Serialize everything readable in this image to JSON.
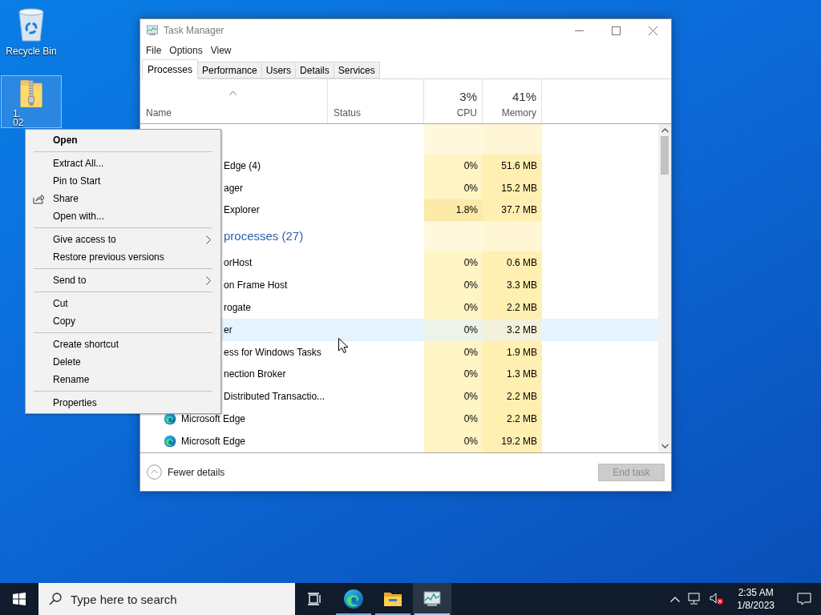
{
  "desktop_icons": [
    {
      "kind": "recycle_bin",
      "label": [
        "Recycle Bin"
      ],
      "selected": false
    },
    {
      "kind": "zip_folder",
      "label": [
        "1.",
        "02"
      ],
      "selected": true
    }
  ],
  "task_manager": {
    "title": "Task Manager",
    "menu": [
      "File",
      "Options",
      "View"
    ],
    "tabs": [
      {
        "label": "Processes",
        "selected": true
      },
      {
        "label": "Performance",
        "selected": false
      },
      {
        "label": "Users",
        "selected": false
      },
      {
        "label": "Details",
        "selected": false
      },
      {
        "label": "Services",
        "selected": false
      }
    ],
    "columns": {
      "name": "Name",
      "status": "Status",
      "cpu": {
        "percent": "3%",
        "label": "CPU"
      },
      "memory": {
        "percent": "41%",
        "label": "Memory"
      }
    },
    "rows": [
      {
        "kind": "group"
      },
      {
        "kind": "process",
        "name": "Edge (4)",
        "cpu": "0%",
        "memory": "51.6 MB",
        "hovered": false,
        "icon_visible": false,
        "cpu_busy": false
      },
      {
        "kind": "process",
        "name": "ager",
        "cpu": "0%",
        "memory": "15.2 MB",
        "hovered": false,
        "icon_visible": false,
        "cpu_busy": false
      },
      {
        "kind": "process",
        "name": "Explorer",
        "cpu": "1.8%",
        "memory": "37.7 MB",
        "hovered": false,
        "icon_visible": false,
        "cpu_busy": true
      },
      {
        "kind": "group",
        "name": "processes (27)"
      },
      {
        "kind": "process",
        "name": "orHost",
        "cpu": "0%",
        "memory": "0.6 MB",
        "hovered": false,
        "icon_visible": false,
        "cpu_busy": false
      },
      {
        "kind": "process",
        "name": "on Frame Host",
        "cpu": "0%",
        "memory": "3.3 MB",
        "hovered": false,
        "icon_visible": false,
        "cpu_busy": false
      },
      {
        "kind": "process",
        "name": "rogate",
        "cpu": "0%",
        "memory": "2.2 MB",
        "hovered": false,
        "icon_visible": false,
        "cpu_busy": false
      },
      {
        "kind": "process",
        "name": "er",
        "cpu": "0%",
        "memory": "3.2 MB",
        "hovered": true,
        "icon_visible": false,
        "cpu_busy": false
      },
      {
        "kind": "process",
        "name": "ess for Windows Tasks",
        "cpu": "0%",
        "memory": "1.9 MB",
        "hovered": false,
        "icon_visible": false,
        "cpu_busy": false
      },
      {
        "kind": "process",
        "name": "nection Broker",
        "cpu": "0%",
        "memory": "1.3 MB",
        "hovered": false,
        "icon_visible": false,
        "cpu_busy": false
      },
      {
        "kind": "process",
        "name": "Distributed Transactio...",
        "cpu": "0%",
        "memory": "2.2 MB",
        "hovered": false,
        "icon_visible": false,
        "cpu_busy": false
      },
      {
        "kind": "process",
        "name": "Microsoft Edge",
        "cpu": "0%",
        "memory": "2.2 MB",
        "hovered": false,
        "icon_visible": true,
        "cpu_busy": false
      },
      {
        "kind": "process",
        "name": "Microsoft Edge",
        "cpu": "0%",
        "memory": "19.2 MB",
        "hovered": false,
        "icon_visible": true,
        "cpu_busy": false
      }
    ],
    "footer": {
      "fewer_details": "Fewer details",
      "end_task": {
        "label": "End task",
        "disabled": true
      }
    }
  },
  "context_menu": [
    {
      "kind": "item",
      "label": "Open",
      "default": true,
      "submenu": false,
      "share_icon": false
    },
    {
      "kind": "separator"
    },
    {
      "kind": "item",
      "label": "Extract All...",
      "default": false,
      "submenu": false,
      "share_icon": false
    },
    {
      "kind": "item",
      "label": "Pin to Start",
      "default": false,
      "submenu": false,
      "share_icon": false
    },
    {
      "kind": "item",
      "label": "Share",
      "default": false,
      "submenu": false,
      "share_icon": true
    },
    {
      "kind": "item",
      "label": "Open with...",
      "default": false,
      "submenu": false,
      "share_icon": false
    },
    {
      "kind": "separator"
    },
    {
      "kind": "item",
      "label": "Give access to",
      "default": false,
      "submenu": true,
      "share_icon": false
    },
    {
      "kind": "item",
      "label": "Restore previous versions",
      "default": false,
      "submenu": false,
      "share_icon": false
    },
    {
      "kind": "separator"
    },
    {
      "kind": "item",
      "label": "Send to",
      "default": false,
      "submenu": true,
      "share_icon": false
    },
    {
      "kind": "separator"
    },
    {
      "kind": "item",
      "label": "Cut",
      "default": false,
      "submenu": false,
      "share_icon": false
    },
    {
      "kind": "item",
      "label": "Copy",
      "default": false,
      "submenu": false,
      "share_icon": false
    },
    {
      "kind": "separator"
    },
    {
      "kind": "item",
      "label": "Create shortcut",
      "default": false,
      "submenu": false,
      "share_icon": false
    },
    {
      "kind": "item",
      "label": "Delete",
      "default": false,
      "submenu": false,
      "share_icon": false
    },
    {
      "kind": "item",
      "label": "Rename",
      "default": false,
      "submenu": false,
      "share_icon": false
    },
    {
      "kind": "separator"
    },
    {
      "kind": "item",
      "label": "Properties",
      "default": false,
      "submenu": false,
      "share_icon": false
    }
  ],
  "taskbar": {
    "search": {
      "placeholder": "Type here to search"
    },
    "apps": [
      {
        "kind": "task_view",
        "running": false,
        "active": false
      },
      {
        "kind": "edge",
        "running": true,
        "active": false
      },
      {
        "kind": "file_explorer",
        "running": true,
        "active": false
      },
      {
        "kind": "task_manager",
        "running": true,
        "active": true
      }
    ],
    "clock": {
      "time": "2:35 AM",
      "date": "1/8/2023"
    }
  }
}
